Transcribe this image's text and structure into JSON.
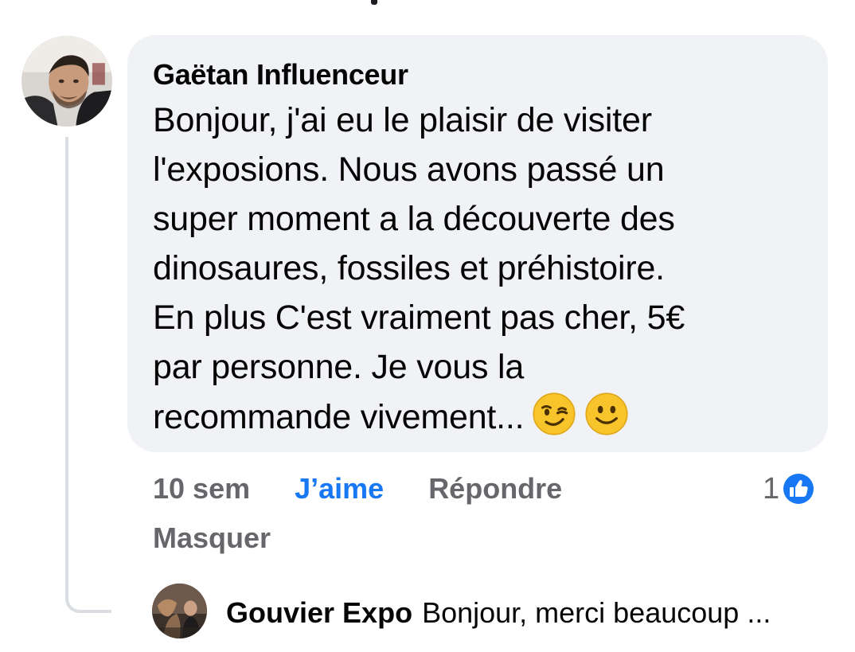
{
  "comment": {
    "author": "Gaëtan Influenceur",
    "lines": [
      "Bonjour, j'ai eu le plaisir de visiter",
      "l'exposions. Nous avons passé un",
      "super moment a la découverte des",
      "dinosaures, fossiles et préhistoire.",
      "En plus C'est vraiment pas cher, 5€",
      "par personne. Je vous la",
      "recommande vivement..."
    ],
    "emojis": [
      "winking-face",
      "smiling-face"
    ]
  },
  "actions": {
    "time": "10 sem",
    "like": "J’aime",
    "reply": "Répondre",
    "hide": "Masquer"
  },
  "reactions": {
    "count": "1",
    "icon": "like-thumb",
    "color": "#1877f2"
  },
  "reply": {
    "author": "Gouvier Expo",
    "preview": "Bonjour, merci beaucoup ..."
  }
}
